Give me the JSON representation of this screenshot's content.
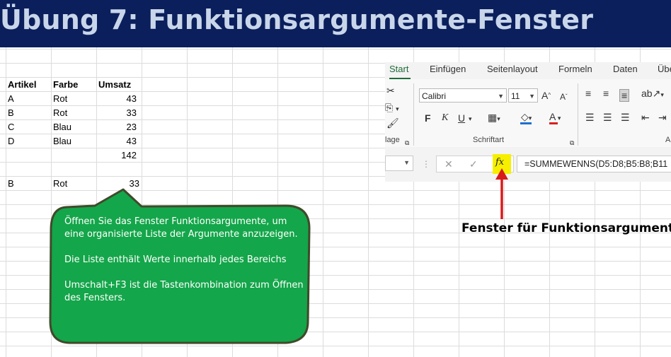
{
  "page": {
    "title": "Übung 7: Funktionsargumente-Fenster"
  },
  "spreadsheet": {
    "headers": [
      "Artikel",
      "Farbe",
      "Umsatz"
    ],
    "rows": [
      {
        "artikel": "A",
        "farbe": "Rot",
        "umsatz": "43"
      },
      {
        "artikel": "B",
        "farbe": "Rot",
        "umsatz": "33"
      },
      {
        "artikel": "C",
        "farbe": "Blau",
        "umsatz": "23"
      },
      {
        "artikel": "D",
        "farbe": "Blau",
        "umsatz": "43"
      }
    ],
    "total": "142",
    "query": {
      "artikel": "B",
      "farbe": "Rot",
      "umsatz": "33"
    }
  },
  "ribbon": {
    "tabs": [
      "Start",
      "Einfügen",
      "Seitenlayout",
      "Formeln",
      "Daten",
      "Übe"
    ],
    "active_tab": "Start",
    "font_name": "Calibri",
    "font_size": "11",
    "group_labels": {
      "clipboard": "lage",
      "font": "Schriftart"
    },
    "font_buttons": {
      "bold": "F",
      "italic": "K",
      "underline": "U"
    },
    "grow_font": "A",
    "shrink_font": "A",
    "font_color": "A"
  },
  "formula_bar": {
    "fx": "fx",
    "formula": "=SUMMEWENNS(D5:D8;B5:B8;B11"
  },
  "annotation": {
    "label": "Fenster für Funktionsargumente",
    "arrow_color": "#d81b1b"
  },
  "callout": {
    "paragraphs": [
      "Öffnen Sie das Fenster Funktionsargumente, um eine organisierte Liste der Argumente anzuzeigen.",
      "Die Liste enthält Werte innerhalb jedes Bereichs",
      "Umschalt+F3 ist die Tastenkombination zum Öffnen des Fensters."
    ],
    "fill_color": "#14a64a",
    "border_color": "#3f4a2a"
  },
  "colors": {
    "title_bg": "#0b1f5c",
    "title_text": "#c9d6ea",
    "highlight": "#f6f000",
    "excel_green": "#1e6b3a"
  }
}
